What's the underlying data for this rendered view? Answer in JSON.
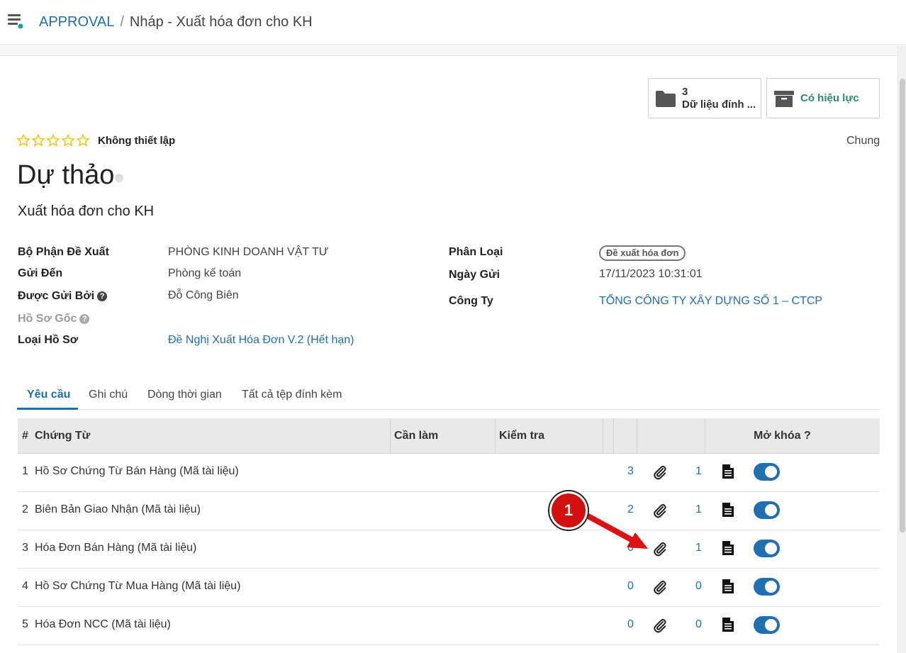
{
  "header": {
    "app": "APPROVAL",
    "separator": "/",
    "current": "Nháp - Xuất hóa đơn cho KH"
  },
  "smart_buttons": {
    "attachments_count": "3",
    "attachments_label": "Dữ liệu đính ...",
    "status_label": "Có hiệu lực"
  },
  "record": {
    "priority_label": "Không thiết lập",
    "category_right": "Chung",
    "title": "Dự thảo",
    "subtitle": "Xuất hóa đơn cho KH"
  },
  "fields": {
    "department_label": "Bộ Phận Đề Xuất",
    "department_value": "PHÒNG KINH DOANH VẬT TƯ",
    "send_to_label": "Gửi Đến",
    "send_to_value": "Phòng kế toán",
    "sent_by_label": "Được Gửi Bởi",
    "sent_by_value": "Đỗ Công Biên",
    "origin_label": "Hồ Sơ Gốc",
    "doc_type_label": "Loại Hồ Sơ",
    "doc_type_value": "Đề Nghị Xuất Hóa Đơn V.2 (Hết hạn)",
    "classification_label": "Phân Loại",
    "classification_value": "Đề xuất hóa đơn",
    "date_label": "Ngày Gửi",
    "date_value": "17/11/2023 10:31:01",
    "company_label": "Công Ty",
    "company_value": "TỔNG CÔNG TY XÂY DỰNG SỐ 1 – CTCP"
  },
  "tabs": [
    "Yêu cầu",
    "Ghi chú",
    "Dòng thời gian",
    "Tất cả tệp đính kèm"
  ],
  "table": {
    "headers": {
      "num": "#",
      "document": "Chứng Từ",
      "todo": "Cần làm",
      "check": "Kiểm tra",
      "unlock": "Mở khóa ?"
    },
    "rows": [
      {
        "num": "1",
        "name": "Hồ Sơ Chứng Từ Bán Hàng (Mã tài liệu)",
        "attach": "3",
        "count": "1",
        "unlocked": true
      },
      {
        "num": "2",
        "name": "Biên Bản Giao Nhận (Mã tài liệu)",
        "attach": "2",
        "count": "1",
        "unlocked": true
      },
      {
        "num": "3",
        "name": "Hóa Đơn Bán Hàng (Mã tài liệu)",
        "attach": "0",
        "count": "1",
        "unlocked": true
      },
      {
        "num": "4",
        "name": "Hồ Sơ Chứng Từ Mua Hàng (Mã tài liệu)",
        "attach": "0",
        "count": "0",
        "unlocked": true
      },
      {
        "num": "5",
        "name": "Hóa Đơn NCC (Mã tài liệu)",
        "attach": "0",
        "count": "0",
        "unlocked": true
      }
    ]
  },
  "annotation": {
    "label": "1"
  },
  "icons": {
    "menu": "menu-icon",
    "folder": "folder-icon",
    "archive": "archive-icon",
    "star": "star-outline-icon",
    "help": "question-circle-icon",
    "paperclip": "paperclip-icon",
    "document": "file-text-icon"
  },
  "colors": {
    "link": "#1f6fb2",
    "star": "#f3c300",
    "active_status": "#2a8a6a",
    "toggle_on": "#1f6fb2",
    "annotation": "#d31010"
  }
}
